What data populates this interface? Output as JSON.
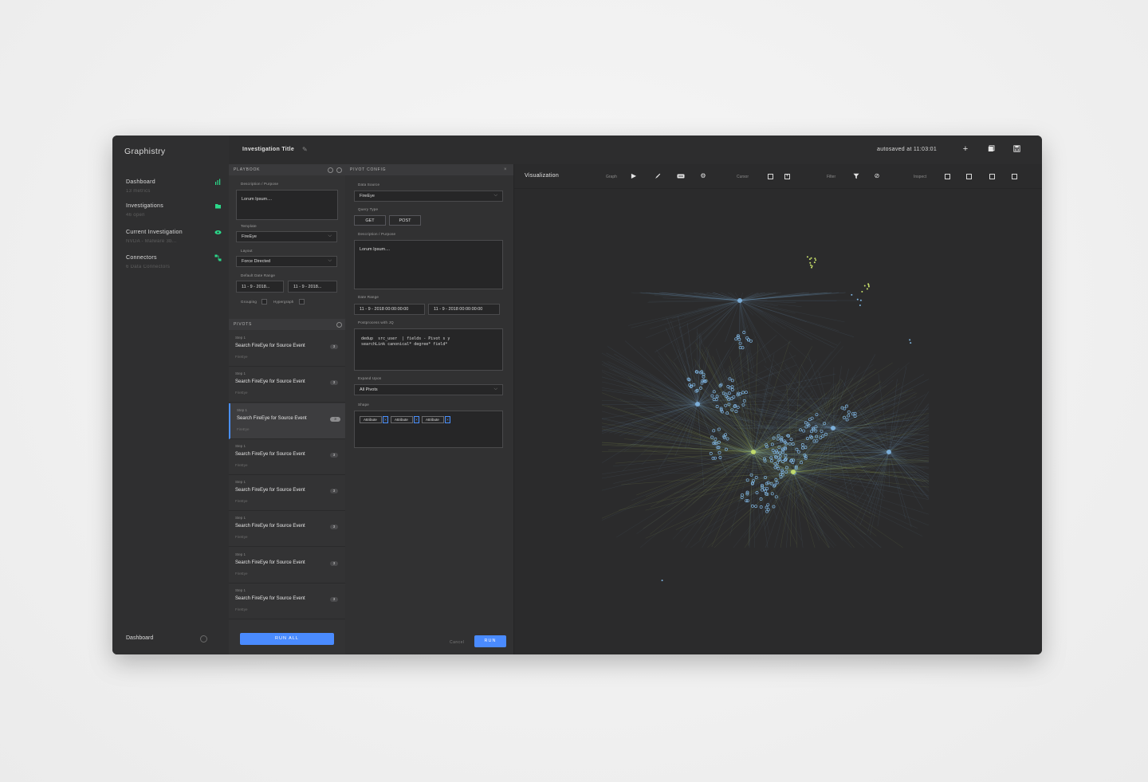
{
  "app": {
    "brand": "Graphistry"
  },
  "nav": {
    "items": [
      {
        "label": "Dashboard",
        "sub": "13 metrics",
        "icon": "bar-chart-icon"
      },
      {
        "label": "Investigations",
        "sub": "46 open",
        "icon": "folder-icon"
      },
      {
        "label": "Current Investigation",
        "sub": "NVDA - Malware 3b...",
        "icon": "eye-icon"
      },
      {
        "label": "Connectors",
        "sub": "6 Data Connectors",
        "icon": "connector-icon"
      }
    ],
    "footer_label": "Dashboard"
  },
  "topbar": {
    "title": "Investigation Title",
    "autosave": "autosaved at 11:03:01"
  },
  "playbook": {
    "header": "PLAYBOOK",
    "description_label": "Description / Purpose",
    "description_value": "Lorum Ipsum....",
    "template_label": "Template",
    "template_value": "FireEye",
    "layout_label": "Layout",
    "layout_value": "Force Directed",
    "date_range_label": "Default Date Range",
    "date_from": "11 - 9 - 2018...",
    "date_to": "11 - 9 - 2018...",
    "grouping_label": "Grouping",
    "hypergraph_label": "Hypergraph",
    "pivots_header": "PIVOTS",
    "pivots": [
      {
        "step": "Step 1",
        "title": "Search FireEye for Source Event",
        "source": "FireEye",
        "count": "3"
      },
      {
        "step": "Step 1",
        "title": "Search FireEye for Source Event",
        "source": "FireEye",
        "count": "3"
      },
      {
        "step": "Step 1",
        "title": "Search FireEye for Source Event",
        "source": "FireEye",
        "count": "3"
      },
      {
        "step": "Step 1",
        "title": "Search FireEye for Source Event",
        "source": "FireEye",
        "count": "3"
      },
      {
        "step": "Step 1",
        "title": "Search FireEye for Source Event",
        "source": "FireEye",
        "count": "3"
      },
      {
        "step": "Step 1",
        "title": "Search FireEye for Source Event",
        "source": "FireEye",
        "count": "3"
      },
      {
        "step": "Step 1",
        "title": "Search FireEye for Source Event",
        "source": "FireEye",
        "count": "3"
      },
      {
        "step": "Step 1",
        "title": "Search FireEye for Source Event",
        "source": "FireEye",
        "count": "3"
      }
    ],
    "run_all": "RUN ALL"
  },
  "pivot_config": {
    "header": "PIVOT CONFIG",
    "data_source_label": "Data Source",
    "data_source_value": "FireEye",
    "query_type_label": "Query Type",
    "get_label": "GET",
    "post_label": "POST",
    "description_label": "Description / Purpose",
    "description_value": "Lorum Ipsum....",
    "date_range_label": "Date Range",
    "date_from": "11 - 9 - 2018 00:00:00:00",
    "date_to": "11 - 9 - 2018 00:00:00:00",
    "postprocess_label": "Postprocess with JQ",
    "postprocess_line1": "dedup  src_user  | fields - Pivot s y",
    "postprocess_line2": "searchLink canonical* degree* field*",
    "expand_label": "Expand Upon",
    "expand_value": "All Pivots",
    "shape_label": "Shape",
    "tags": [
      "Attribute",
      "Attribute",
      "Attribute"
    ],
    "cancel": "Cancel",
    "run": "RUN"
  },
  "visualization": {
    "title": "Visualization",
    "groups": {
      "graph": "Graph",
      "cursor": "Cursor",
      "filter": "Filter",
      "inspect": "Inspect"
    }
  },
  "colors": {
    "accent": "#4a8bff",
    "nav_icon": "#2bd98a",
    "node_blue": "#7fb4e0",
    "node_green": "#c8e06a"
  }
}
